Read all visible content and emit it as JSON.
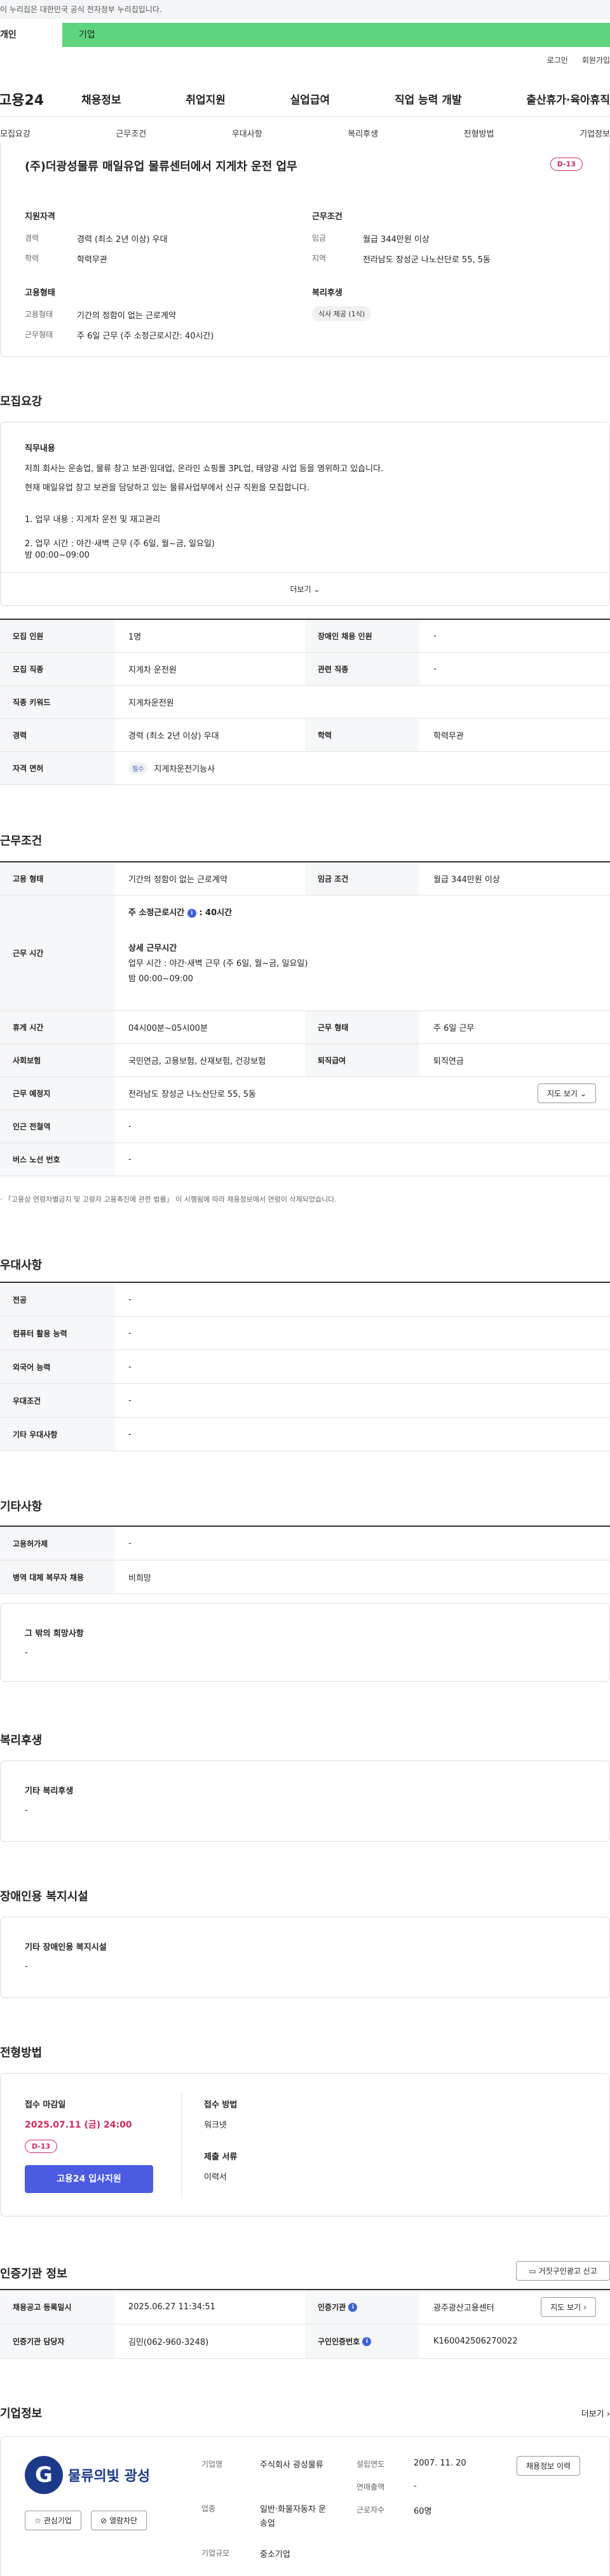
{
  "gov_banner": "이 누리집은 대한민국 공식 전자정부 누리집입니다.",
  "user_tabs": [
    "개인",
    "기업"
  ],
  "util_links": [
    "로그인",
    "회원가입"
  ],
  "logo": "고용24",
  "gnb": [
    "채용정보",
    "취업지원",
    "실업급여",
    "직업 능력 개발",
    "출산휴가·육아휴직"
  ],
  "lnb": [
    "모집요강",
    "근무조건",
    "우대사항",
    "복리후생",
    "전형방법",
    "기업정보"
  ],
  "job": {
    "title": "(주)더광성물류 매일유업 물류센터에서 지게차 운전 업무",
    "dday": "D-13",
    "qual_h": "지원자격",
    "qual": [
      {
        "l": "경력",
        "v": "경력 (최소 2년 이상) 우대"
      },
      {
        "l": "학력",
        "v": "학력무관"
      }
    ],
    "cond_h": "근무조건",
    "cond": [
      {
        "l": "임금",
        "v": "월급 344만원 이상"
      },
      {
        "l": "지역",
        "v": "전라남도 장성군 나노산단로 55, 5동"
      }
    ],
    "emp_h": "고용형태",
    "emp": [
      {
        "l": "고용형태",
        "v": "기간의 정함이 없는 근로계약"
      },
      {
        "l": "근무형태",
        "v": "주 6일 근무 (주 소정근로시간: 40시간)"
      }
    ],
    "welfare_h": "복리후생",
    "welfare_tag": "식사 제공 (1식)"
  },
  "recruit": {
    "h": "모집요강",
    "duty_h": "직무내용",
    "lines": [
      "저희 회사는 운송업, 물류 창고 보관·임대업, 온라인 쇼핑몰 3PL업, 태양광 사업 등을 영위하고 있습니다.",
      "현재 매일유업 창고 보관을 담당하고 있는 물류사업부에서 신규 직원을 모집합니다.",
      "1. 업무 내용 : 지게차 운전 및 재고관리",
      "2. 업무 시간 :  야간·새벽 근무 (주 6일, 월~금, 일요일)",
      "밤  00:00~09:00"
    ],
    "more": "더보기",
    "rows": [
      [
        "모집 인원",
        "1명",
        "장애인 채용 인원",
        "-"
      ],
      [
        "모집 직종",
        "지게차 운전원",
        "관련 직종",
        "-"
      ],
      [
        "직종 키워드",
        "지게차운전원"
      ],
      [
        "경력",
        "경력 (최소 2년 이상) 우대",
        "학력",
        "학력무관"
      ],
      [
        "자격 면허",
        "필수",
        "지게차운전기능사"
      ]
    ]
  },
  "work": {
    "h": "근무조건",
    "emp_l": "고용 형태",
    "emp_v": "기간의 정함이 없는 근로계약",
    "wage_l": "임금 조건",
    "wage_v": "월급 344만원 이상",
    "time_l": "근무 시간",
    "time_a": "주 소정근로시간",
    "time_b": ": 40시간",
    "detail_h": "상세 근무시간",
    "detail1": "업무 시간 :  야간·새벽 근무 (주 6일, 월~금, 일요일)",
    "detail2": "밤  00:00~09:00",
    "rest_l": "휴게 시간",
    "rest_v": "04시00분~05시00분",
    "form_l": "근무 형태",
    "form_v": "주 6일 근무",
    "ins_l": "사회보험",
    "ins_v": "국민연금, 고용보험, 산재보험, 건강보험",
    "ret_l": "퇴직급여",
    "ret_v": "퇴직연금",
    "place_l": "근무 예정지",
    "place_v": "전라남도 장성군 나노산단로 55, 5동",
    "map": "지도 보기",
    "subway_l": "인근 전철역",
    "subway_v": "-",
    "bus_l": "버스 노선 번호",
    "bus_v": "-",
    "note": "「고용상 연령차별금지 및 고령자 고용촉진에 관한 법률」 이 시행됨에 따라 채용정보에서 연령이 삭제되었습니다."
  },
  "pref": {
    "h": "우대사항",
    "rows": [
      [
        "전공",
        "-"
      ],
      [
        "컴퓨터 활용 능력",
        "-"
      ],
      [
        "외국어 능력",
        "-"
      ],
      [
        "우대조건",
        "-"
      ],
      [
        "기타 우대사항",
        "-"
      ]
    ]
  },
  "etc": {
    "h": "기타사항",
    "rows": [
      [
        "고용허가제",
        "-"
      ],
      [
        "병역 대체 복무자 채용",
        "비희망"
      ]
    ],
    "box_h": "그 밖의 희망사항",
    "box_v": "-"
  },
  "welfare": {
    "h": "복리후생",
    "box_h": "기타 복리후생",
    "box_v": "-"
  },
  "disab": {
    "h": "장애인용 복지시설",
    "box_h": "기타 장애인용 복지시설",
    "box_v": "-"
  },
  "apply": {
    "h": "전형방법",
    "deadline_h": "접수 마감일",
    "deadline": "2025.07.11 (금) 24:00",
    "dday": "D-13",
    "btn": "고용24 입사지원",
    "method_h": "접수 방법",
    "method": "워크넷",
    "docs_h": "제출 서류",
    "docs": "이력서"
  },
  "agency": {
    "h": "인증기관 정보",
    "report": "거짓구인광고 신고",
    "rows": [
      [
        "채용공고 등록일시",
        "2025.06.27 11:34:51",
        "인증기관",
        "광주광산고용센터"
      ],
      [
        "인증기관 담당자",
        "김민(062-960-3248)",
        "구인인증번호",
        "K160042506270022"
      ]
    ],
    "map": "지도 보기"
  },
  "company": {
    "h": "기업정보",
    "more": "더보기",
    "logo": "물류의빛 광성",
    "fav": "관심기업",
    "block": "열람차단",
    "f1l": "기업명",
    "f1": "주식회사 광성물류",
    "f2l": "업종",
    "f2": "일반·화물자동차 운송업",
    "f3l": "기업규모",
    "f3": "중소기업",
    "g1l": "설립연도",
    "g1": "2007. 11. 20",
    "g2l": "연매출액",
    "g2": "-",
    "g3l": "근로자수",
    "g3": "60명",
    "jobs": "채용정보 이력"
  },
  "colors": {
    "accent": "#4b5ce3",
    "dday": "#d0285c",
    "tab_green": "#5fd47f"
  }
}
